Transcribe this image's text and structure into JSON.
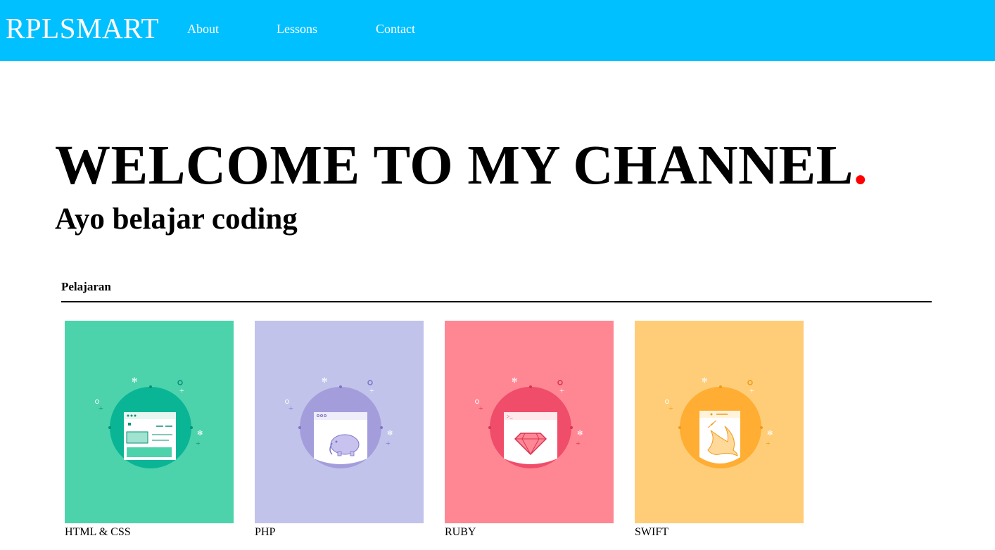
{
  "header": {
    "brand": "RPLSMART",
    "nav": [
      {
        "label": "About"
      },
      {
        "label": "Lessons"
      },
      {
        "label": "Contact"
      }
    ],
    "background_color": "#00c0ff"
  },
  "hero": {
    "title": "WELCOME TO MY CHANNEL",
    "title_dot": ".",
    "title_dot_color": "#ff0000",
    "subtitle": "Ayo belajar coding"
  },
  "lessons": {
    "heading": "Pelajaran",
    "items": [
      {
        "label": "HTML & CSS",
        "icon": "html-css-browser-icon",
        "bg": "#4dd3ab",
        "circle": "#0ab596",
        "accent": "#0a8f77"
      },
      {
        "label": "PHP",
        "icon": "php-elephant-icon",
        "bg": "#c1c3ea",
        "circle": "#a39edb",
        "accent": "#7d75c8"
      },
      {
        "label": "RUBY",
        "icon": "ruby-gem-icon",
        "bg": "#ff8794",
        "circle": "#f04d6a",
        "accent": "#d63553"
      },
      {
        "label": "SWIFT",
        "icon": "swift-bird-icon",
        "bg": "#ffcd78",
        "circle": "#ffad33",
        "accent": "#f09a1a"
      }
    ]
  }
}
